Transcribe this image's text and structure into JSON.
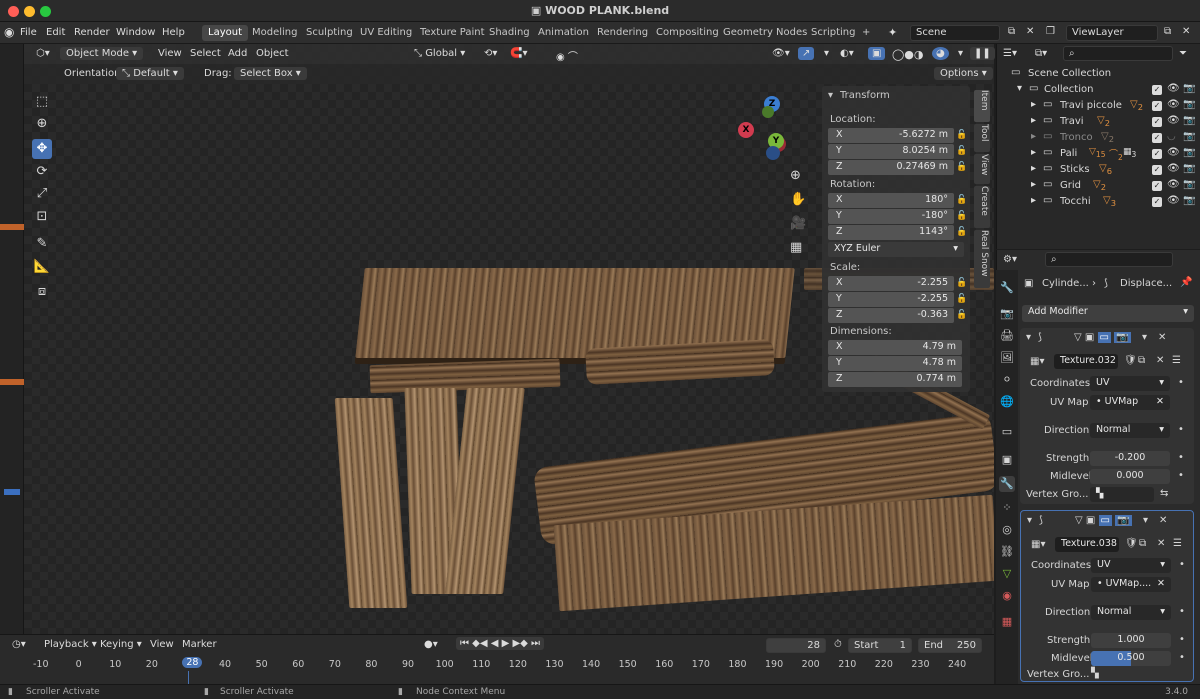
{
  "window": {
    "title": "WOOD PLANK.blend"
  },
  "menus": [
    "File",
    "Edit",
    "Render",
    "Window",
    "Help"
  ],
  "workspaces": [
    "Layout",
    "Modeling",
    "Sculpting",
    "UV Editing",
    "Texture Paint",
    "Shading",
    "Animation",
    "Rendering",
    "Compositing",
    "Geometry Nodes",
    "Scripting"
  ],
  "active_workspace": "Layout",
  "add_workspace": "+",
  "scene": {
    "name": "Scene",
    "view_layer": "ViewLayer"
  },
  "viewport": {
    "mode": "Object Mode",
    "menus": [
      "View",
      "Select",
      "Add",
      "Object"
    ],
    "transform_orientation": "Global",
    "orientation_label": "Orientation:",
    "orientation_value": "Default",
    "drag_label": "Drag:",
    "drag_value": "Select Box",
    "options": "Options",
    "gizmo": {
      "x": "X",
      "y": "Y",
      "z": "Z"
    }
  },
  "npanel": {
    "header": "Transform",
    "location_label": "Location:",
    "location": [
      {
        "axis": "X",
        "value": "-5.6272 m"
      },
      {
        "axis": "Y",
        "value": "8.0254 m"
      },
      {
        "axis": "Z",
        "value": "0.27469 m"
      }
    ],
    "rotation_label": "Rotation:",
    "rotation": [
      {
        "axis": "X",
        "value": "180°"
      },
      {
        "axis": "Y",
        "value": "-180°"
      },
      {
        "axis": "Z",
        "value": "1143°"
      }
    ],
    "rotation_mode": "XYZ Euler",
    "scale_label": "Scale:",
    "scale": [
      {
        "axis": "X",
        "value": "-2.255"
      },
      {
        "axis": "Y",
        "value": "-2.255"
      },
      {
        "axis": "Z",
        "value": "-0.363"
      }
    ],
    "dimensions_label": "Dimensions:",
    "dimensions": [
      {
        "axis": "X",
        "value": "4.79 m"
      },
      {
        "axis": "Y",
        "value": "4.78 m"
      },
      {
        "axis": "Z",
        "value": "0.774 m"
      }
    ],
    "tabs": [
      "Item",
      "Tool",
      "View",
      "Create",
      "Real Snow"
    ]
  },
  "outliner": {
    "root": "Scene Collection",
    "collection": "Collection",
    "items": [
      {
        "name": "Travi piccole",
        "badge": "2"
      },
      {
        "name": "Travi",
        "badge": "2"
      },
      {
        "name": "Tronco",
        "badge": "2"
      },
      {
        "name": "Pali",
        "badge": "15",
        "badge2": "2",
        "badge3": "3"
      },
      {
        "name": "Sticks",
        "badge": "6"
      },
      {
        "name": "Grid",
        "badge": "2"
      },
      {
        "name": "Tocchi",
        "badge": "3"
      }
    ]
  },
  "properties": {
    "breadcrumb_object": "Cylinde...",
    "breadcrumb_modifier": "Displace...",
    "add_modifier": "Add Modifier",
    "modifiers": [
      {
        "texture": "Texture.032",
        "coordinates_label": "Coordinates",
        "coordinates": "UV",
        "uvmap_label": "UV Map",
        "uvmap": "UVMap",
        "direction_label": "Direction",
        "direction": "Normal",
        "strength_label": "Strength",
        "strength": "-0.200",
        "midlevel_label": "Midlevel",
        "midlevel": "0.000",
        "vgroup_label": "Vertex Gro..."
      },
      {
        "texture": "Texture.038",
        "coordinates_label": "Coordinates",
        "coordinates": "UV",
        "uvmap_label": "UV Map",
        "uvmap": "UVMap....",
        "direction_label": "Direction",
        "direction": "Normal",
        "strength_label": "Strength",
        "strength": "1.000",
        "midlevel_label": "Midlevel",
        "midlevel": "0.500",
        "vgroup_label": "Vertex Gro..."
      }
    ]
  },
  "timeline": {
    "menus": [
      "Playback",
      "Keying",
      "View",
      "Marker"
    ],
    "current_frame": "28",
    "start_label": "Start",
    "start": "1",
    "end_label": "End",
    "end": "250",
    "ticks": [
      "-10",
      "0",
      "10",
      "20",
      "28",
      "40",
      "50",
      "60",
      "70",
      "80",
      "90",
      "100",
      "110",
      "120",
      "130",
      "140",
      "150",
      "160",
      "170",
      "180",
      "190",
      "200",
      "210",
      "220",
      "230",
      "240"
    ]
  },
  "status": {
    "left": "Scroller Activate",
    "middle": "Scroller Activate",
    "right": "Node Context Menu",
    "version": "3.4.0"
  },
  "colors": {
    "accent": "#4772b3",
    "header": "#2e2e2e",
    "panel": "#303030",
    "x_axis": "#d23b4f",
    "y_axis": "#7ab83a",
    "z_axis": "#3b7ed2"
  }
}
